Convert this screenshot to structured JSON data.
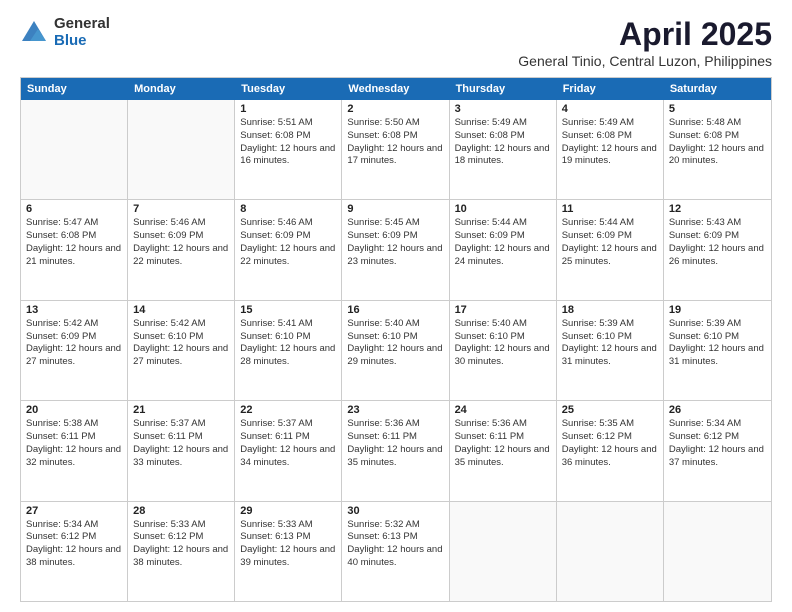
{
  "logo": {
    "general": "General",
    "blue": "Blue"
  },
  "title": "April 2025",
  "subtitle": "General Tinio, Central Luzon, Philippines",
  "header_days": [
    "Sunday",
    "Monday",
    "Tuesday",
    "Wednesday",
    "Thursday",
    "Friday",
    "Saturday"
  ],
  "weeks": [
    [
      {
        "day": "",
        "sunrise": "",
        "sunset": "",
        "daylight": ""
      },
      {
        "day": "",
        "sunrise": "",
        "sunset": "",
        "daylight": ""
      },
      {
        "day": "1",
        "sunrise": "Sunrise: 5:51 AM",
        "sunset": "Sunset: 6:08 PM",
        "daylight": "Daylight: 12 hours and 16 minutes."
      },
      {
        "day": "2",
        "sunrise": "Sunrise: 5:50 AM",
        "sunset": "Sunset: 6:08 PM",
        "daylight": "Daylight: 12 hours and 17 minutes."
      },
      {
        "day": "3",
        "sunrise": "Sunrise: 5:49 AM",
        "sunset": "Sunset: 6:08 PM",
        "daylight": "Daylight: 12 hours and 18 minutes."
      },
      {
        "day": "4",
        "sunrise": "Sunrise: 5:49 AM",
        "sunset": "Sunset: 6:08 PM",
        "daylight": "Daylight: 12 hours and 19 minutes."
      },
      {
        "day": "5",
        "sunrise": "Sunrise: 5:48 AM",
        "sunset": "Sunset: 6:08 PM",
        "daylight": "Daylight: 12 hours and 20 minutes."
      }
    ],
    [
      {
        "day": "6",
        "sunrise": "Sunrise: 5:47 AM",
        "sunset": "Sunset: 6:08 PM",
        "daylight": "Daylight: 12 hours and 21 minutes."
      },
      {
        "day": "7",
        "sunrise": "Sunrise: 5:46 AM",
        "sunset": "Sunset: 6:09 PM",
        "daylight": "Daylight: 12 hours and 22 minutes."
      },
      {
        "day": "8",
        "sunrise": "Sunrise: 5:46 AM",
        "sunset": "Sunset: 6:09 PM",
        "daylight": "Daylight: 12 hours and 22 minutes."
      },
      {
        "day": "9",
        "sunrise": "Sunrise: 5:45 AM",
        "sunset": "Sunset: 6:09 PM",
        "daylight": "Daylight: 12 hours and 23 minutes."
      },
      {
        "day": "10",
        "sunrise": "Sunrise: 5:44 AM",
        "sunset": "Sunset: 6:09 PM",
        "daylight": "Daylight: 12 hours and 24 minutes."
      },
      {
        "day": "11",
        "sunrise": "Sunrise: 5:44 AM",
        "sunset": "Sunset: 6:09 PM",
        "daylight": "Daylight: 12 hours and 25 minutes."
      },
      {
        "day": "12",
        "sunrise": "Sunrise: 5:43 AM",
        "sunset": "Sunset: 6:09 PM",
        "daylight": "Daylight: 12 hours and 26 minutes."
      }
    ],
    [
      {
        "day": "13",
        "sunrise": "Sunrise: 5:42 AM",
        "sunset": "Sunset: 6:09 PM",
        "daylight": "Daylight: 12 hours and 27 minutes."
      },
      {
        "day": "14",
        "sunrise": "Sunrise: 5:42 AM",
        "sunset": "Sunset: 6:10 PM",
        "daylight": "Daylight: 12 hours and 27 minutes."
      },
      {
        "day": "15",
        "sunrise": "Sunrise: 5:41 AM",
        "sunset": "Sunset: 6:10 PM",
        "daylight": "Daylight: 12 hours and 28 minutes."
      },
      {
        "day": "16",
        "sunrise": "Sunrise: 5:40 AM",
        "sunset": "Sunset: 6:10 PM",
        "daylight": "Daylight: 12 hours and 29 minutes."
      },
      {
        "day": "17",
        "sunrise": "Sunrise: 5:40 AM",
        "sunset": "Sunset: 6:10 PM",
        "daylight": "Daylight: 12 hours and 30 minutes."
      },
      {
        "day": "18",
        "sunrise": "Sunrise: 5:39 AM",
        "sunset": "Sunset: 6:10 PM",
        "daylight": "Daylight: 12 hours and 31 minutes."
      },
      {
        "day": "19",
        "sunrise": "Sunrise: 5:39 AM",
        "sunset": "Sunset: 6:10 PM",
        "daylight": "Daylight: 12 hours and 31 minutes."
      }
    ],
    [
      {
        "day": "20",
        "sunrise": "Sunrise: 5:38 AM",
        "sunset": "Sunset: 6:11 PM",
        "daylight": "Daylight: 12 hours and 32 minutes."
      },
      {
        "day": "21",
        "sunrise": "Sunrise: 5:37 AM",
        "sunset": "Sunset: 6:11 PM",
        "daylight": "Daylight: 12 hours and 33 minutes."
      },
      {
        "day": "22",
        "sunrise": "Sunrise: 5:37 AM",
        "sunset": "Sunset: 6:11 PM",
        "daylight": "Daylight: 12 hours and 34 minutes."
      },
      {
        "day": "23",
        "sunrise": "Sunrise: 5:36 AM",
        "sunset": "Sunset: 6:11 PM",
        "daylight": "Daylight: 12 hours and 35 minutes."
      },
      {
        "day": "24",
        "sunrise": "Sunrise: 5:36 AM",
        "sunset": "Sunset: 6:11 PM",
        "daylight": "Daylight: 12 hours and 35 minutes."
      },
      {
        "day": "25",
        "sunrise": "Sunrise: 5:35 AM",
        "sunset": "Sunset: 6:12 PM",
        "daylight": "Daylight: 12 hours and 36 minutes."
      },
      {
        "day": "26",
        "sunrise": "Sunrise: 5:34 AM",
        "sunset": "Sunset: 6:12 PM",
        "daylight": "Daylight: 12 hours and 37 minutes."
      }
    ],
    [
      {
        "day": "27",
        "sunrise": "Sunrise: 5:34 AM",
        "sunset": "Sunset: 6:12 PM",
        "daylight": "Daylight: 12 hours and 38 minutes."
      },
      {
        "day": "28",
        "sunrise": "Sunrise: 5:33 AM",
        "sunset": "Sunset: 6:12 PM",
        "daylight": "Daylight: 12 hours and 38 minutes."
      },
      {
        "day": "29",
        "sunrise": "Sunrise: 5:33 AM",
        "sunset": "Sunset: 6:13 PM",
        "daylight": "Daylight: 12 hours and 39 minutes."
      },
      {
        "day": "30",
        "sunrise": "Sunrise: 5:32 AM",
        "sunset": "Sunset: 6:13 PM",
        "daylight": "Daylight: 12 hours and 40 minutes."
      },
      {
        "day": "",
        "sunrise": "",
        "sunset": "",
        "daylight": ""
      },
      {
        "day": "",
        "sunrise": "",
        "sunset": "",
        "daylight": ""
      },
      {
        "day": "",
        "sunrise": "",
        "sunset": "",
        "daylight": ""
      }
    ]
  ]
}
